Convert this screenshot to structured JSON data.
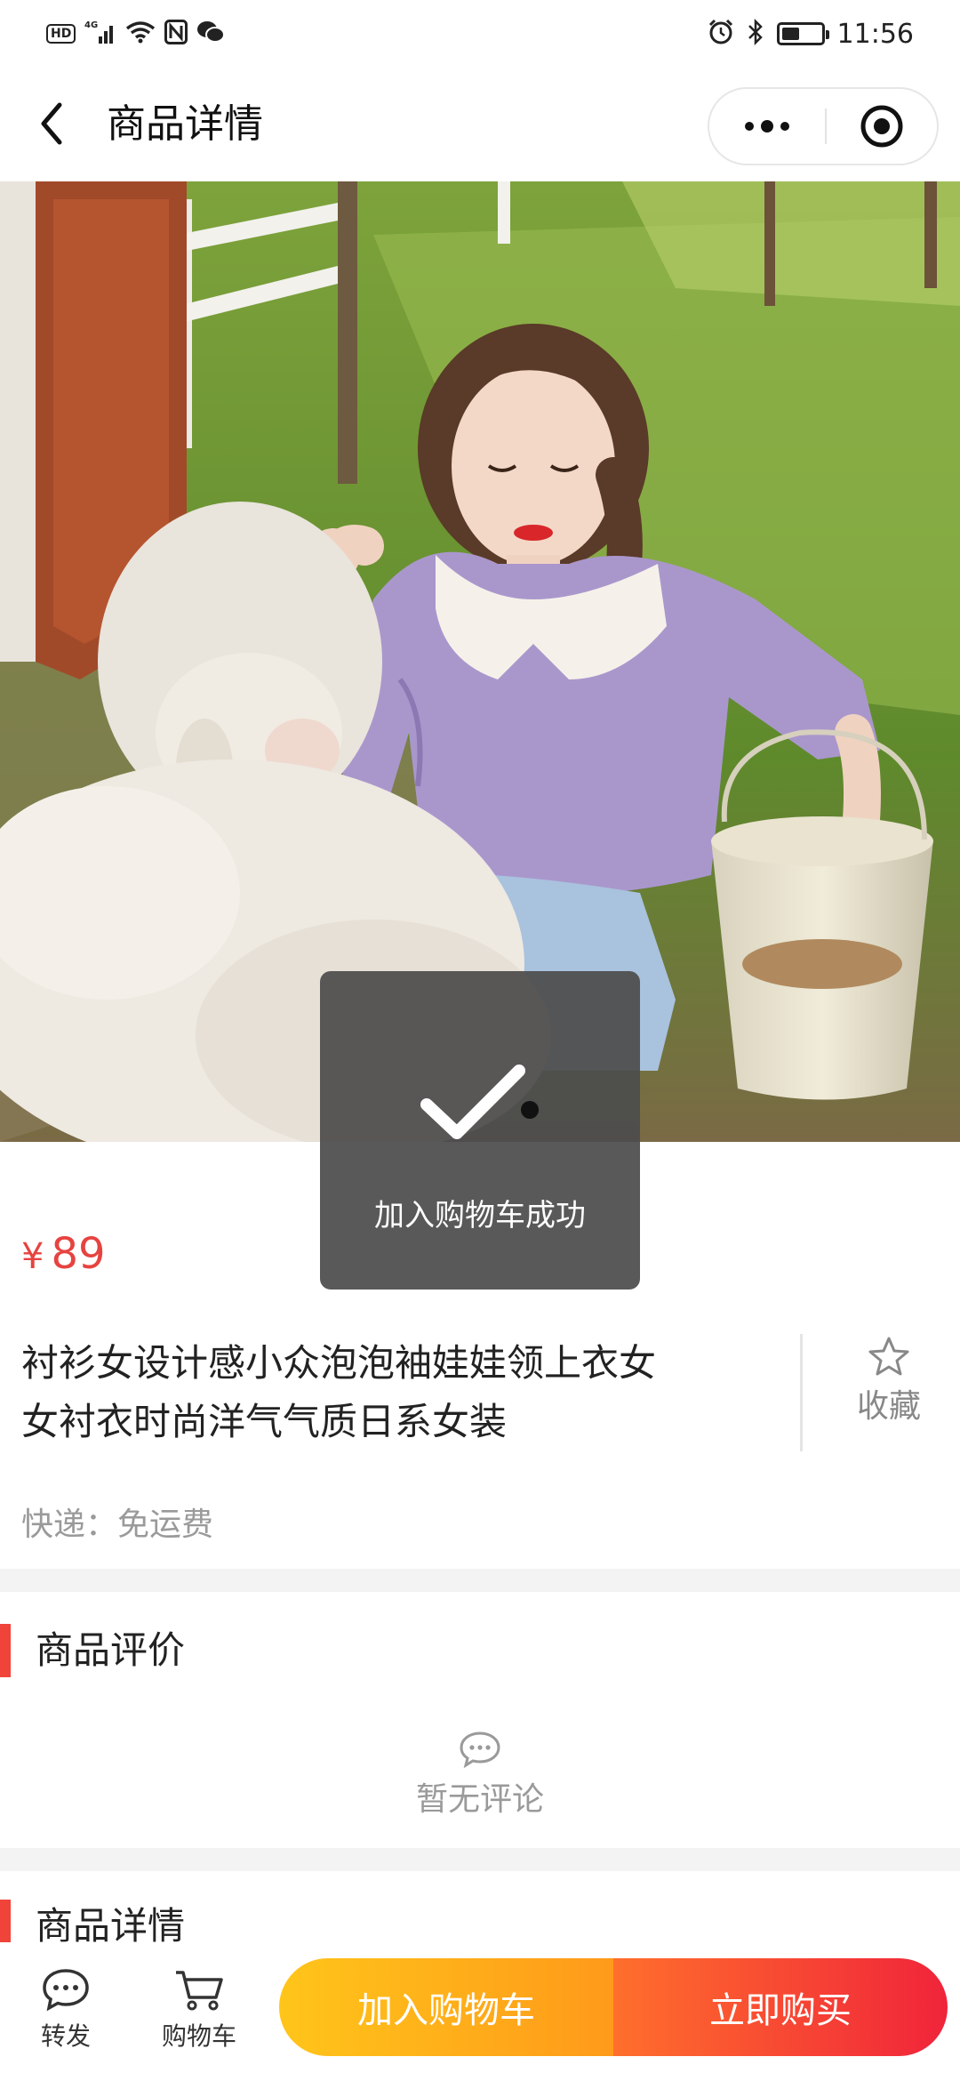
{
  "status_bar": {
    "network_label": "HD",
    "signal_label": "4G",
    "time": "11:56",
    "battery_level": 0.45,
    "icons": [
      "hd-icon",
      "signal-icon",
      "wifi-icon",
      "nfc-icon",
      "wechat-icon",
      "alarm-icon",
      "bluetooth-icon",
      "battery-icon"
    ]
  },
  "nav": {
    "title": "商品详情",
    "back_icon": "chevron-left-icon",
    "more_icon": "more-dots-icon",
    "close_icon": "target-close-icon"
  },
  "product": {
    "currency_symbol": "¥",
    "price": "89",
    "title_line1": "衬衫女设计感小众泡泡袖娃娃领上衣女",
    "title_line2": "女衬衣时尚洋气气质日系女装",
    "favorite_label": "收藏",
    "shipping": "快递：免运费"
  },
  "reviews": {
    "section_title": "商品评价",
    "empty_text": "暂无评论"
  },
  "details": {
    "section_title": "商品详情"
  },
  "bottom_bar": {
    "share_label": "转发",
    "cart_label": "购物车",
    "add_to_cart": "加入购物车",
    "buy_now": "立即购买"
  },
  "toast": {
    "message": "加入购物车成功",
    "icon": "checkmark-icon"
  },
  "colors": {
    "price_red": "#e64340",
    "accent_bar": "#f0443a",
    "cart_gradient_start": "#ffc51a",
    "cart_gradient_end": "#ff9a1a",
    "buy_gradient_start": "#ff6f2c",
    "buy_gradient_end": "#f0243a"
  }
}
